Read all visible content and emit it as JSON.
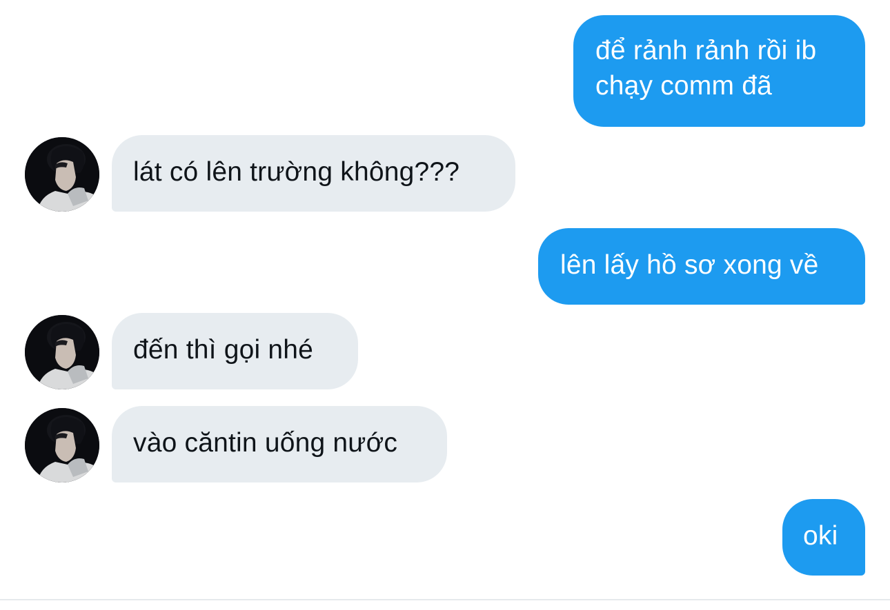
{
  "conversation": {
    "messages": [
      {
        "direction": "outgoing",
        "text": "để rảnh rảnh rồi ib\nchạy comm đã"
      },
      {
        "direction": "incoming",
        "text": "lát có lên trường không???"
      },
      {
        "direction": "outgoing",
        "text": "lên lấy hồ sơ xong về"
      },
      {
        "direction": "incoming",
        "text": "đến thì gọi nhé"
      },
      {
        "direction": "incoming",
        "text": "vào căntin uống nước"
      },
      {
        "direction": "outgoing",
        "text": "oki"
      }
    ]
  },
  "colors": {
    "outgoing_bubble": "#1d9bf0",
    "incoming_bubble": "#e7ecf0",
    "incoming_text": "#0f1419",
    "background": "#ffffff"
  },
  "icons": {
    "avatar": "user-avatar-photo"
  }
}
